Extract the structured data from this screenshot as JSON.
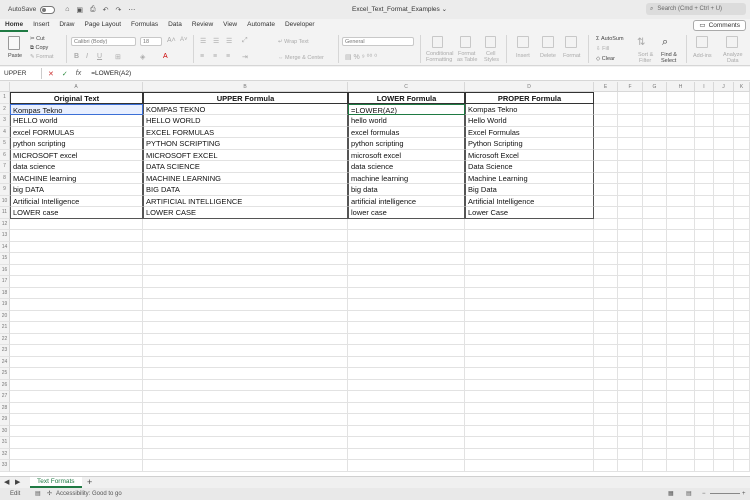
{
  "titlebar": {
    "autosave_label": "AutoSave",
    "doc_title": "Excel_Text_Format_Examples ⌄",
    "search_placeholder": "Search (Cmd + Ctrl + U)"
  },
  "menu": [
    "Home",
    "Insert",
    "Draw",
    "Page Layout",
    "Formulas",
    "Data",
    "Review",
    "View",
    "Automate",
    "Developer"
  ],
  "comments_label": "Comments",
  "ribbon": {
    "paste": "Paste",
    "cut": "Cut",
    "copy": "Copy",
    "format": "Format",
    "font_name": "Calibri (Body)",
    "font_size": "18",
    "wrap_text": "Wrap Text",
    "merge_center": "Merge & Center",
    "number_format": "General",
    "cond_format_1": "Conditional",
    "cond_format_2": "Formatting",
    "fmt_table_1": "Format",
    "fmt_table_2": "as Table",
    "cell_styles_1": "Cell",
    "cell_styles_2": "Styles",
    "insert": "Insert",
    "delete": "Delete",
    "format_cells": "Format",
    "autosum": "AutoSum",
    "fill": "Fill",
    "clear": "Clear",
    "sort_1": "Sort &",
    "sort_2": "Filter",
    "find_1": "Find &",
    "find_2": "Select",
    "addins": "Add-ins",
    "analyze_1": "Analyze",
    "analyze_2": "Data"
  },
  "formula_bar": {
    "name_box": "UPPER",
    "content": "=LOWER(A2)"
  },
  "columns": [
    "A",
    "B",
    "C",
    "D",
    "E",
    "F",
    "G",
    "H",
    "I",
    "J",
    "K"
  ],
  "header_row": [
    "Original Text",
    "UPPER Formula",
    "LOWER Formula",
    "PROPER Formula"
  ],
  "rows": [
    [
      "Kompas Tekno",
      "KOMPAS TEKNO",
      "=LOWER(A2)",
      "Kompas Tekno"
    ],
    [
      "HELLO world",
      "HELLO WORLD",
      "hello world",
      "Hello World"
    ],
    [
      "excel FORMULAS",
      "EXCEL FORMULAS",
      "excel formulas",
      "Excel Formulas"
    ],
    [
      "python scripting",
      "PYTHON SCRIPTING",
      "python scripting",
      "Python Scripting"
    ],
    [
      "MICROSOFT excel",
      "MICROSOFT EXCEL",
      "microsoft excel",
      "Microsoft Excel"
    ],
    [
      "data science",
      "DATA SCIENCE",
      "data science",
      "Data Science"
    ],
    [
      "MACHINE learning",
      "MACHINE LEARNING",
      "machine learning",
      "Machine Learning"
    ],
    [
      "big DATA",
      "BIG DATA",
      "big data",
      "Big Data"
    ],
    [
      "Artificial Intelligence",
      "ARTIFICIAL INTELLIGENCE",
      "artificial intelligence",
      "Artificial Intelligence"
    ],
    [
      "LOWER case",
      "LOWER CASE",
      "lower case",
      "Lower Case"
    ]
  ],
  "sheet_tab": "Text Formats",
  "status": {
    "mode": "Edit",
    "accessibility": "Accessibility: Good to go"
  }
}
